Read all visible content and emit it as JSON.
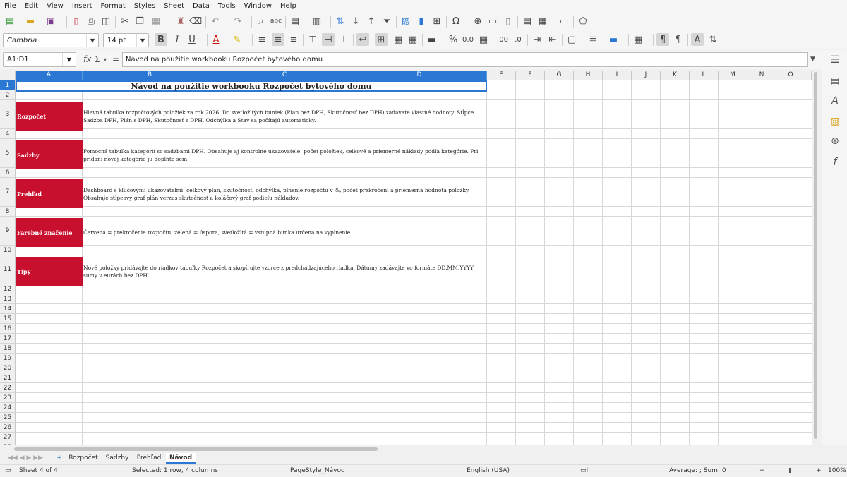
{
  "menu": [
    "File",
    "Edit",
    "View",
    "Insert",
    "Format",
    "Styles",
    "Sheet",
    "Data",
    "Tools",
    "Window",
    "Help"
  ],
  "format_bar": {
    "font_name": "Cambria",
    "font_size": "14 pt"
  },
  "formula_bar": {
    "name_box": "A1:D1",
    "content": "Návod na použitie workbooku Rozpočet bytového domu"
  },
  "columns": [
    "A",
    "B",
    "C",
    "D",
    "E",
    "F",
    "G",
    "H",
    "I",
    "J",
    "K",
    "L",
    "M",
    "N",
    "O"
  ],
  "rows": [
    "1",
    "2",
    "3",
    "4",
    "5",
    "6",
    "7",
    "8",
    "9",
    "10",
    "11",
    "12",
    "13",
    "14",
    "15",
    "16",
    "17",
    "18",
    "19",
    "20",
    "21",
    "22",
    "23",
    "24",
    "25",
    "26",
    "27",
    "28"
  ],
  "sheet": {
    "title": "Návod na použitie workbooku Rozpočet bytového domu",
    "sections": [
      {
        "label": "Rozpočet",
        "text": "Hlavná tabuľka rozpočtových položiek za rok 2026. Do svetložltých buniek (Plán bez DPH, Skutočnosť bez DPH) zadávate vlastné hodnoty. Stĺpce Sadzba DPH, Plán s DPH, Skutočnosť s DPH, Odchýlka a Stav sa počítajú automaticky."
      },
      {
        "label": "Sadzby",
        "text": "Pomocná tabuľka kategórií so sadzbami DPH. Obsahuje aj kontrolné ukazovatele: počet položiek, celkové a priemerné náklady podľa kategórie. Pri pridaní novej kategórie ju doplňte sem."
      },
      {
        "label": "Prehľad",
        "text": "Dashboard s kľúčovými ukazovateľmi: celkový plán, skutočnosť, odchýlka, plnenie rozpočtu v %, počet prekročení a priemerná hodnota položky. Obsahuje stĺpcový graf plán verzus skutočnosť a koláčový graf podielu nákladov."
      },
      {
        "label": "Farebné značenie",
        "text": "Červená = prekročenie rozpočtu, zelená = úspora, svetložltá = vstupná bunka určená na vyplnenie."
      },
      {
        "label": "Tipy",
        "text": "Nové položky pridávajte do riadkov tabuľky Rozpočet a skopírujte vzorce z predchádzajúceho riadka. Dátumy zadávajte vo formáte DD.MM.YYYY, sumy v eurách bez DPH."
      }
    ]
  },
  "tabs": [
    "Rozpočet",
    "Sadzby",
    "Prehľad",
    "Návod"
  ],
  "active_tab": "Návod",
  "status": {
    "sheet": "Sheet 4 of 4",
    "selection": "Selected: 1 row, 4 columns",
    "page_style": "PageStyle_Návod",
    "language": "English (USA)",
    "sum": "Average: ; Sum: 0",
    "zoom": "100%"
  },
  "colors": {
    "accent": "#2b78d4",
    "label_red": "#c8102e"
  }
}
